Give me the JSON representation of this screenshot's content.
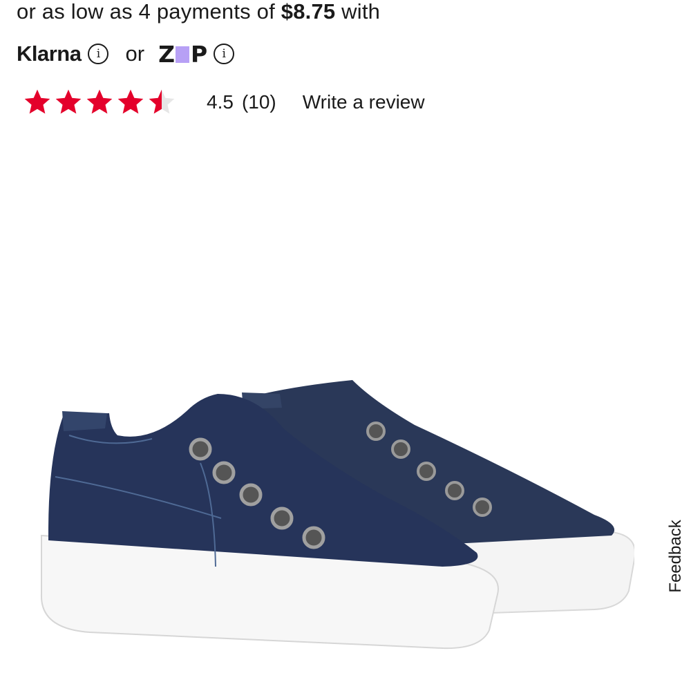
{
  "payments": {
    "prefix": "or as low as 4 payments of ",
    "amount": "$8.75",
    "suffix": " with",
    "klarna": "Klarna",
    "or": "or",
    "zip_left": "Z",
    "zip_right": "P",
    "info_glyph": "i"
  },
  "rating": {
    "value": "4.5",
    "count": "(10)",
    "stars_filled": 4.5,
    "stars_total": 5,
    "star_color": "#e4002b",
    "write_review": "Write a review"
  },
  "product_image": {
    "icon": "sneaker-image",
    "color": "#2b3a5c"
  },
  "feedback": {
    "label": "Feedback"
  }
}
